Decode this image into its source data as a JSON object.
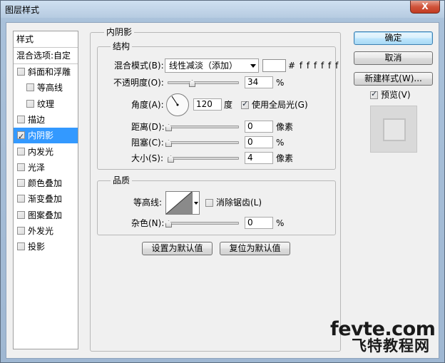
{
  "window": {
    "title": "图层样式",
    "close_label": "X"
  },
  "sidebar": {
    "header": "样式",
    "blend_options": "混合选项:自定",
    "items": [
      {
        "label": "斜面和浮雕",
        "checked": false,
        "indent": false
      },
      {
        "label": "等高线",
        "checked": false,
        "indent": true
      },
      {
        "label": "纹理",
        "checked": false,
        "indent": true
      },
      {
        "label": "描边",
        "checked": false,
        "indent": false
      },
      {
        "label": "内阴影",
        "checked": true,
        "indent": false,
        "selected": true
      },
      {
        "label": "内发光",
        "checked": false,
        "indent": false
      },
      {
        "label": "光泽",
        "checked": false,
        "indent": false
      },
      {
        "label": "颜色叠加",
        "checked": false,
        "indent": false
      },
      {
        "label": "渐变叠加",
        "checked": false,
        "indent": false
      },
      {
        "label": "图案叠加",
        "checked": false,
        "indent": false
      },
      {
        "label": "外发光",
        "checked": false,
        "indent": false
      },
      {
        "label": "投影",
        "checked": false,
        "indent": false
      }
    ]
  },
  "panel": {
    "title": "内阴影",
    "structure": {
      "title": "结构",
      "blend_mode_label": "混合模式(B):",
      "blend_mode_value": "线性减淡（添加）",
      "color_hex": "# f f f f f f",
      "color": "#ffffff",
      "opacity_label": "不透明度(O):",
      "opacity_value": "34",
      "opacity_unit": "%",
      "angle_label": "角度(A):",
      "angle_value": "120",
      "angle_unit": "度",
      "global_light_label": "使用全局光(G)",
      "global_light_checked": true,
      "distance_label": "距离(D):",
      "distance_value": "0",
      "distance_unit": "像素",
      "choke_label": "阻塞(C):",
      "choke_value": "0",
      "choke_unit": "%",
      "size_label": "大小(S):",
      "size_value": "4",
      "size_unit": "像素"
    },
    "quality": {
      "title": "品质",
      "contour_label": "等高线:",
      "antialias_label": "消除锯齿(L)",
      "antialias_checked": false,
      "noise_label": "杂色(N):",
      "noise_value": "0",
      "noise_unit": "%"
    },
    "make_default": "设置为默认值",
    "reset_default": "复位为默认值"
  },
  "actions": {
    "ok": "确定",
    "cancel": "取消",
    "new_style": "新建样式(W)...",
    "preview_label": "预览(V)",
    "preview_checked": true
  },
  "watermark": {
    "line1": "fevte.com",
    "line2": "飞特教程网"
  }
}
